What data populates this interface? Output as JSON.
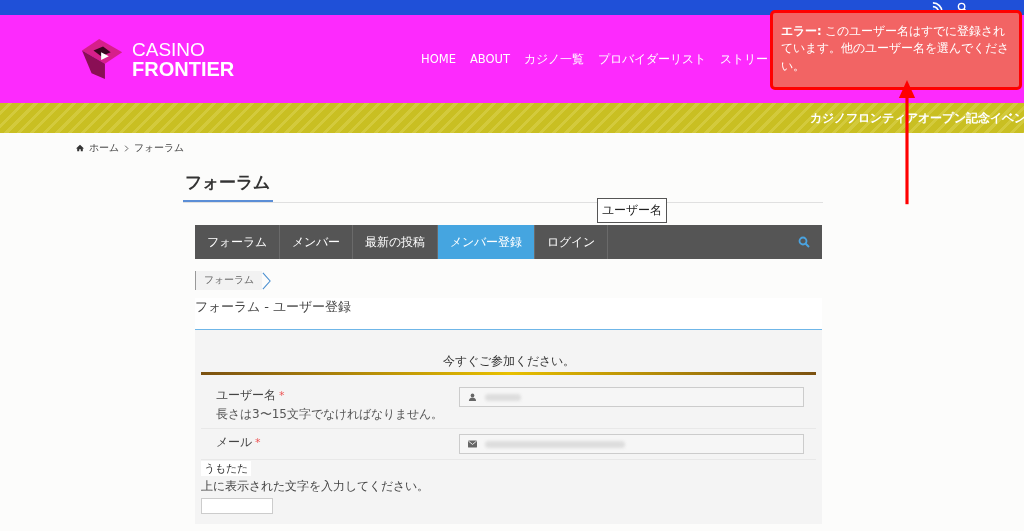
{
  "logo": {
    "line1": "CASINO",
    "line2": "FRONTIER"
  },
  "nav": [
    "HOME",
    "ABOUT",
    "カジノ一覧",
    "プロバイダーリスト",
    "ストリー"
  ],
  "banner": {
    "text": "カジノフロンティアオープン記念イベン"
  },
  "error_toast": {
    "label": "エラー:",
    "message": "このユーザー名はすでに登録されています。他のユーザー名を選んでください。"
  },
  "breadcrumb": [
    "ホーム",
    "フォーラム"
  ],
  "page_title": "フォーラム",
  "tooltip": "ユーザー名",
  "forum_tabs": [
    {
      "label": "フォーラム",
      "selected": false
    },
    {
      "label": "メンバー",
      "selected": false
    },
    {
      "label": "最新の投稿",
      "selected": false
    },
    {
      "label": "メンバー登録",
      "selected": true
    },
    {
      "label": "ログイン",
      "selected": false
    }
  ],
  "forum_breadcrumb": "フォーラム",
  "forum_title": "フォーラム - ユーザー登録",
  "form": {
    "heading": "今すぐご参加ください。",
    "fields": [
      {
        "label": "ユーザー名",
        "required_mark": "*",
        "hint": "長さは3〜15文字でなければなりません。",
        "kind": "user"
      },
      {
        "label": "メール",
        "required_mark": "*",
        "kind": "mail"
      }
    ],
    "captcha": "うもたた",
    "captcha_instruction": "上に表示された文字を入力してください。"
  }
}
